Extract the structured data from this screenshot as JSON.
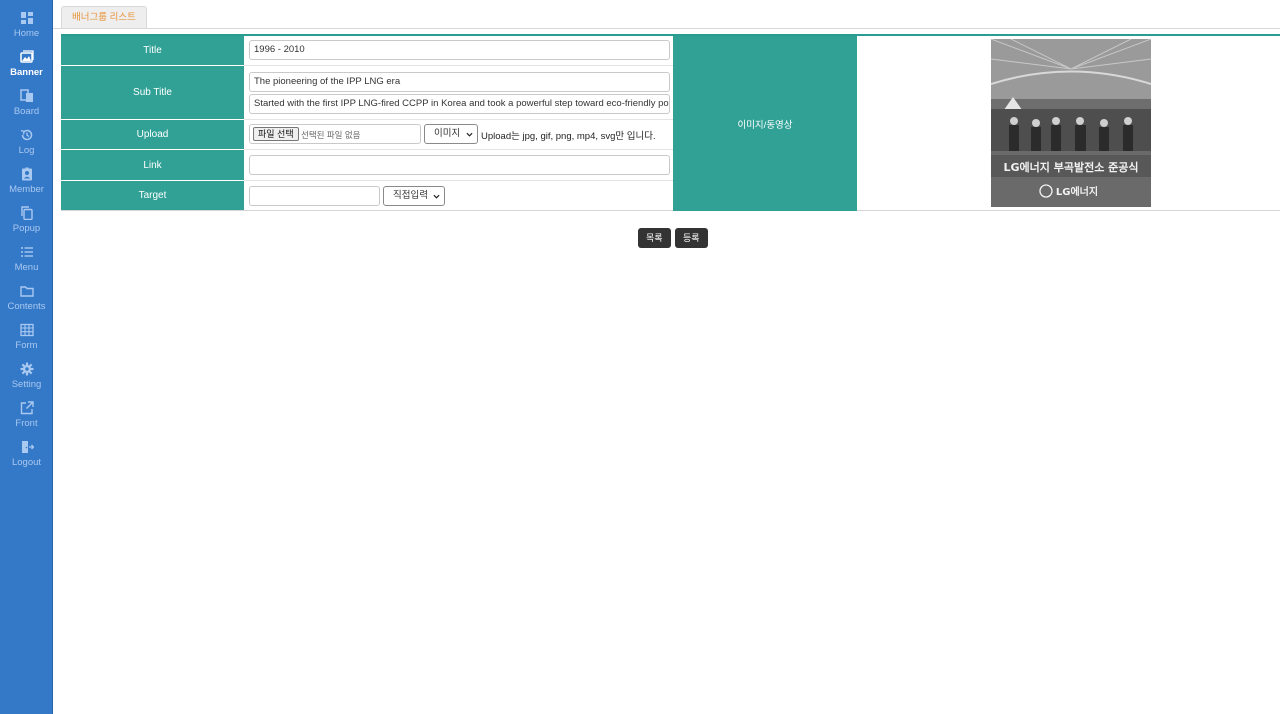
{
  "sidebar": {
    "items": [
      {
        "label": "Home",
        "icon": "dashboard-icon"
      },
      {
        "label": "Banner",
        "icon": "image-icon",
        "active": true
      },
      {
        "label": "Board",
        "icon": "board-icon"
      },
      {
        "label": "Log",
        "icon": "history-icon"
      },
      {
        "label": "Member",
        "icon": "member-badge-icon"
      },
      {
        "label": "Popup",
        "icon": "copy-icon"
      },
      {
        "label": "Menu",
        "icon": "list-icon"
      },
      {
        "label": "Contents",
        "icon": "folder-icon"
      },
      {
        "label": "Form",
        "icon": "table-icon"
      },
      {
        "label": "Setting",
        "icon": "gear-icon"
      },
      {
        "label": "Front",
        "icon": "external-link-icon"
      },
      {
        "label": "Logout",
        "icon": "logout-icon"
      }
    ]
  },
  "tabs": {
    "banner_group_list": "배너그룹 리스트"
  },
  "form": {
    "title_label": "Title",
    "title_value": "1996 - 2010",
    "subtitle_label": "Sub Title",
    "subtitle_line1": "The pioneering of the IPP LNG era",
    "subtitle_line2": "Started with the first IPP LNG-fired CCPP in Korea and took a powerful step toward eco-friendly po",
    "upload_label": "Upload",
    "file_button": "파일 선택",
    "file_status": "선택된 파일 없음",
    "media_type": "이미지",
    "upload_hint": "Upload는 jpg, gif, png, mp4, svg만 입니다.",
    "link_label": "Link",
    "link_value": "",
    "target_label": "Target",
    "target_value": "",
    "target_option": "직접입력",
    "media_label": "이미지/동영상"
  },
  "preview": {
    "caption1": "LG에너지 부곡발전소 준공식",
    "caption2": "LG에너지"
  },
  "actions": {
    "list": "목록",
    "register": "등록"
  },
  "colors": {
    "sidebar": "#3478c8",
    "label_bg": "#31a196",
    "tab_text": "#e8943a",
    "button_bg": "#333333"
  }
}
